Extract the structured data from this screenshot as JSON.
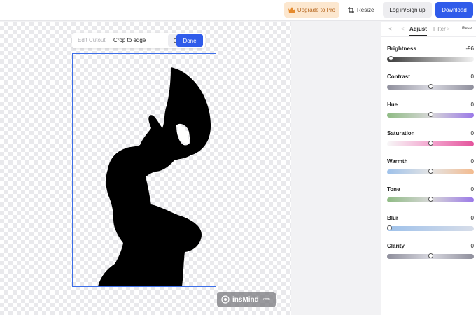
{
  "header": {
    "upgrade_label": "Upgrade to Pro",
    "resize_label": "Resize",
    "login_label": "Log in/Sign up",
    "download_label": "Download"
  },
  "cutout_toolbar": {
    "edit_label": "Edit Cutout",
    "crop_label": "Crop to edge",
    "cancel_label": "Cancel",
    "done_label": "Done"
  },
  "watermark": {
    "brand": "insMind",
    "suffix": ".com"
  },
  "panel": {
    "back_glyph": "<",
    "prev_glyph": "<",
    "tabs": [
      "Adjust",
      "Filter"
    ],
    "next_glyph": ">",
    "reset_label": "Reset",
    "adjustments": [
      {
        "label": "Brightness",
        "value": "-96",
        "level": 0.02,
        "gradient": [
          "#3a3a3a",
          "#f2f2f2"
        ]
      },
      {
        "label": "Contrast",
        "value": "0",
        "level": 0.5,
        "gradient": [
          "#8f8f9c",
          "#d8d8e0",
          "#8f8f9c"
        ]
      },
      {
        "label": "Hue",
        "value": "0",
        "level": 0.5,
        "gradient": [
          "#8fbb84",
          "#d7d7d7",
          "#9b79e8"
        ]
      },
      {
        "label": "Saturation",
        "value": "0",
        "level": 0.5,
        "gradient": [
          "#f7f7f7",
          "#f3a6cf",
          "#e4549c"
        ]
      },
      {
        "label": "Warmth",
        "value": "0",
        "level": 0.5,
        "gradient": [
          "#9ec1ea",
          "#e4e4e4",
          "#f3bb8f"
        ]
      },
      {
        "label": "Tone",
        "value": "0",
        "level": 0.5,
        "gradient": [
          "#8fbb84",
          "#d7d7d7",
          "#9b79e8"
        ]
      },
      {
        "label": "Blur",
        "value": "0",
        "level": 0.0,
        "gradient": [
          "#9ec1ea",
          "#d7dde9"
        ]
      },
      {
        "label": "Clarity",
        "value": "0",
        "level": 0.5,
        "gradient": [
          "#8f8f9c",
          "#d8d8e0",
          "#8f8f9c"
        ]
      }
    ]
  },
  "colors": {
    "accent": "#2f5bea",
    "pro_bg": "#fce7cf",
    "pro_text": "#b5651d"
  }
}
